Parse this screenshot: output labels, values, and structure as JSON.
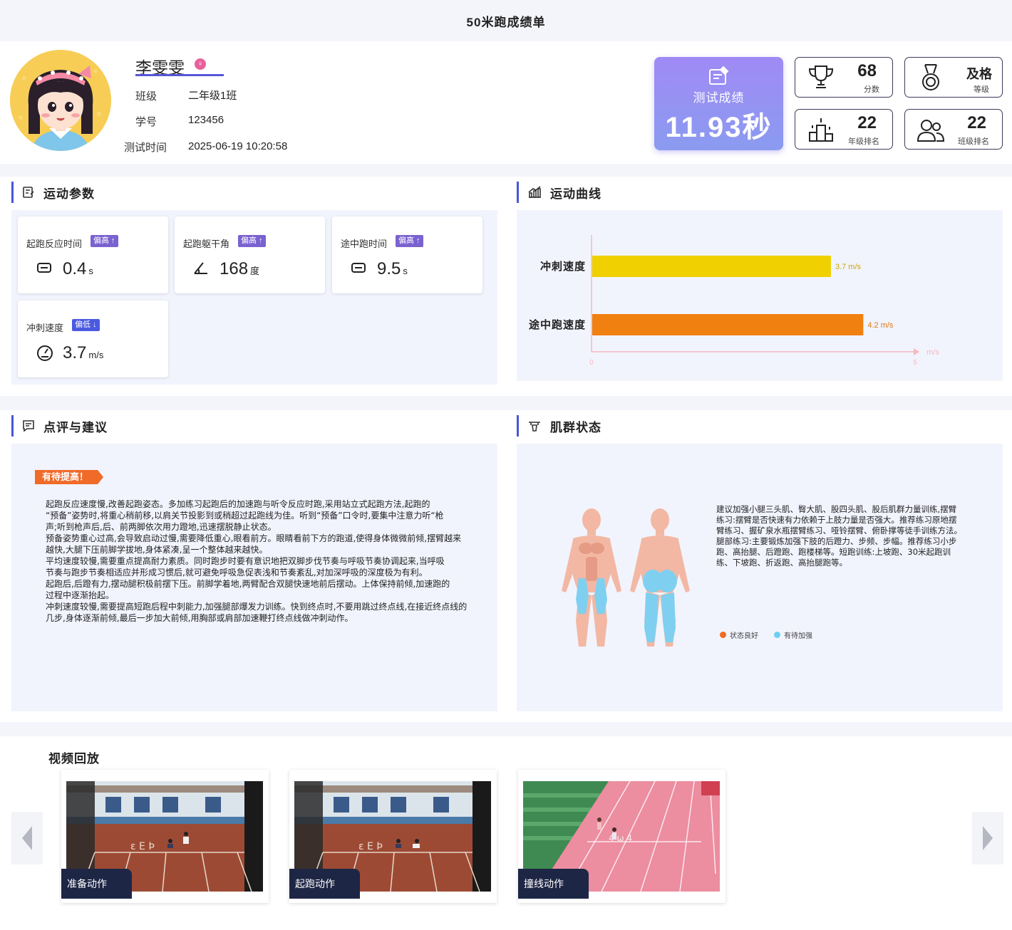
{
  "page": {
    "title": "50米跑成绩单"
  },
  "student": {
    "name": "李雯雯",
    "gender_icon": "female-icon",
    "class_label": "班级",
    "class_value": "二年级1班",
    "id_label": "学号",
    "id_value": "123456",
    "time_label": "测试时间",
    "time_value": "2025-06-19 10:20:58"
  },
  "result": {
    "label": "测试成绩",
    "value": "11.93秒"
  },
  "stats": [
    {
      "icon": "trophy-icon",
      "value": "68",
      "label": "分数"
    },
    {
      "icon": "medal-icon",
      "value": "及格",
      "label": "等级"
    },
    {
      "icon": "podium-icon",
      "value": "22",
      "label": "年级排名"
    },
    {
      "icon": "users-icon",
      "value": "22",
      "label": "班级排名"
    }
  ],
  "sections": {
    "params": "运动参数",
    "curve": "运动曲线",
    "review": "点评与建议",
    "muscle": "肌群状态",
    "video": "视频回放"
  },
  "params": [
    {
      "label": "起跑反应时间",
      "tag": "偏高",
      "value": "0.4",
      "unit": "s",
      "icon": "timer-icon"
    },
    {
      "label": "起跑躯干角",
      "tag": "偏高",
      "value": "168",
      "unit": "度",
      "icon": "angle-icon"
    },
    {
      "label": "途中跑时间",
      "tag": "偏高",
      "value": "9.5",
      "unit": "s",
      "icon": "timer-icon"
    },
    {
      "label": "冲刺速度",
      "tag": "偏低",
      "value": "3.7",
      "unit": "m/s",
      "icon": "speedometer-icon"
    }
  ],
  "chart_data": {
    "type": "bar",
    "orientation": "horizontal",
    "categories": [
      "冲刺速度",
      "途中跑速度"
    ],
    "values": [
      3.7,
      4.2
    ],
    "value_labels": [
      "3.7 m/s",
      "4.2 m/s"
    ],
    "colors": [
      "#f0d000",
      "#f08010"
    ],
    "xlim": [
      0,
      5
    ],
    "x_ticks": [
      "0",
      "5"
    ],
    "xlabel": "m/s",
    "grid": false
  },
  "review": {
    "badge": "有待提高！",
    "paragraphs": [
      "起跑反应速度慢,改善起跑姿态。多加练习起跑后的加速跑与听令反应时跑,采用站立式起跑方法,起跑的",
      "",
      "“预备”姿势时,将重心稍前移,以肩关节投影到或稍超过起跑线为佳。听到“预备”口令时,要集中注意力听“枪",
      "声;听到枪声后,后、前两脚依次用力蹬地,迅速摆脱静止状态。",
      "预备姿势重心过高,会导致启动过慢,需要降低重心,眼看前方。眼睛看前下方的跑道,使得身体微微前倾,摆臂越来越快,大腿下压前脚学拔地,身体紧凑,呈一个整体越来越快。",
      "平均速度较慢,需要重点提高耐力素质。同时跑步时要有意识地把双脚步伐节奏与呼吸节奏协调起来,当呼吸",
      "节奏与跑步节奏相适应并形成习惯后,就可避免呼吸急促表浅和节奏紊乱,对加深呼吸的深度极为有利。",
      "起跑后,后蹬有力,摆动腿积极前摆下压。前脚学着地,两臂配合双腿快速地前后摆动。上体保持前倾,加速跑的",
      "过程中逐渐抬起。",
      "冲刺速度较慢,需要提高短跑后程中刺能力,加强腿部爆发力训练。快到终点时,不要用跳过终点线,在接近终点线的几步,身体逐渐前倾,最后一步加大前倾,用胸部或肩部加速鞭打终点线做冲刺动作。"
    ]
  },
  "muscle": {
    "paragraphs": [
      "建议加强小腿三头肌、臀大肌、股四头肌、股后肌群力量训练,摆臂",
      "练习:摆臂是否快速有力依赖于上肢力量是否强大。推荐练习原地摆",
      "臂练习、握矿泉水瓶摆臂练习、哑铃摆臂、俯卧撑等徒手训练方法。",
      "腿部练习:主要锻炼加强下肢的后蹬力、步频、步幅。推荐练习小步",
      "跑、高抬腿、后蹬跑、跑楼梯等。短跑训练:上坡跑、30米起跑训",
      "练、下坡跑、折返跑、高抬腿跑等。"
    ],
    "legend": [
      {
        "label": "状态良好",
        "color": "#f06a20"
      },
      {
        "label": "有待加强",
        "color": "#6ad0f0"
      }
    ]
  },
  "videos": [
    {
      "caption": "准备动作"
    },
    {
      "caption": "起跑动作"
    },
    {
      "caption": "撞线动作"
    }
  ]
}
